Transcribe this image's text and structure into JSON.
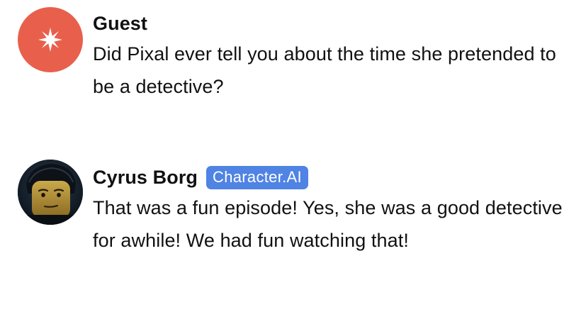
{
  "messages": [
    {
      "sender": "Guest",
      "avatar_icon": "sparkle-icon",
      "avatar_color": "#e8604c",
      "text": "Did Pixal ever tell you about the time she pretended to be a detective?"
    },
    {
      "sender": "Cyrus Borg",
      "badge": "Character.AI",
      "badge_color": "#4f83e4",
      "avatar_icon": "character-portrait-icon",
      "text": "That was a fun episode! Yes, she was a good detective for awhile! We had fun watching that!"
    }
  ]
}
